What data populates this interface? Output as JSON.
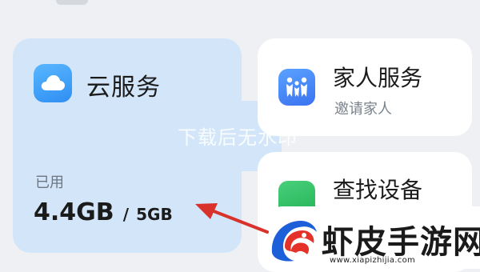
{
  "cloud_card": {
    "title": "云服务",
    "used_label": "已用",
    "used_value": "4.4GB",
    "separator": "/",
    "total_value": "5GB",
    "icon": "cloud-icon"
  },
  "family_card": {
    "title": "家人服务",
    "subtitle": "邀请家人",
    "icon": "family-icon"
  },
  "find_card": {
    "title": "查找设备",
    "icon": "find-device-icon"
  },
  "watermark": "下载后无水印",
  "logo": {
    "name": "虾皮手游网",
    "url": "www.xiapizhijia.com"
  },
  "colors": {
    "cloud_card_bg": "#d3e6f9",
    "arrow": "#d8322a",
    "cloud_icon": "#3f9ff5",
    "family_icon": "#4a86f5",
    "find_icon": "#2fbf62"
  }
}
